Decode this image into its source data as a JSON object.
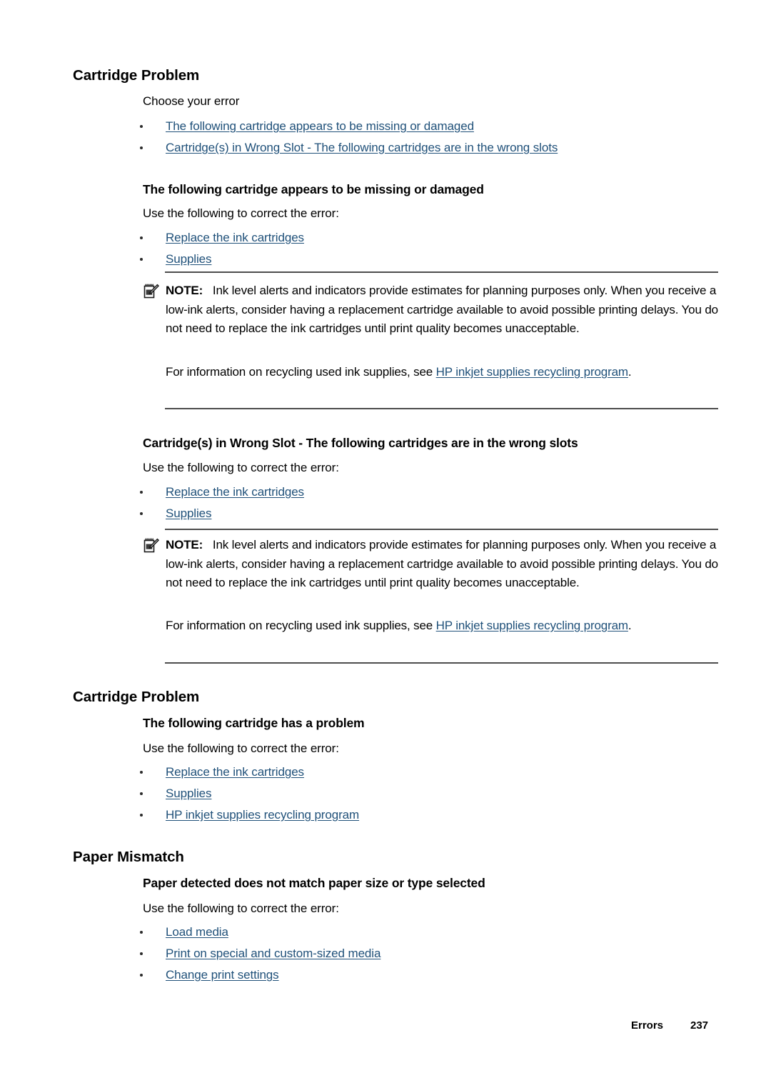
{
  "document": {
    "page_number": "237",
    "footer_section": "Errors",
    "link_color": "#1f5079",
    "rule_color": "#4d4d4d",
    "text_color": "#000000"
  },
  "sections": [
    {
      "id": "cartridge-problem-1",
      "heading": "Cartridge Problem",
      "intro": "Choose your error",
      "toc_links": [
        "The following cartridge appears to be missing or damaged",
        "Cartridge(s) in Wrong Slot - The following cartridges are in the wrong slots"
      ]
    },
    {
      "id": "missing-or-damaged",
      "heading": "The following cartridge appears to be missing or damaged",
      "intro": "Use the following to correct the error:",
      "links": [
        "Replace the ink cartridges",
        "Supplies"
      ]
    },
    {
      "id": "wrong-slot",
      "heading": "Cartridge(s) in Wrong Slot - The following cartridges are in the wrong slots",
      "intro": "Use the following to correct the error:",
      "links": [
        "Replace the ink cartridges",
        "Supplies"
      ]
    },
    {
      "id": "cartridge-problem-2",
      "heading": "Cartridge Problem",
      "subheading": "The following cartridge has a problem",
      "intro": "Use the following to correct the error:",
      "links": [
        "Replace the ink cartridges",
        "Supplies",
        "HP inkjet supplies recycling program"
      ]
    },
    {
      "id": "paper-mismatch",
      "heading": "Paper Mismatch",
      "subheading": "Paper detected does not match paper size or type selected",
      "intro": "Use the following to correct the error:",
      "links": [
        "Load media",
        "Print on special and custom-sized media",
        "Change print settings"
      ]
    }
  ],
  "notes": [
    {
      "id": "note-1",
      "label": "NOTE:",
      "paragraph1": "Ink level alerts and indicators provide estimates for planning purposes only. When you receive a low-ink alerts, consider having a replacement cartridge available to avoid possible printing delays. You do not need to replace the ink cartridges until print quality becomes unacceptable.",
      "paragraph2_before": "For information on recycling used ink supplies, see ",
      "paragraph2_link": "HP inkjet supplies recycling program",
      "paragraph2_after": "."
    },
    {
      "id": "note-2",
      "label": "NOTE:",
      "paragraph1": "Ink level alerts and indicators provide estimates for planning purposes only. When you receive a low-ink alerts, consider having a replacement cartridge available to avoid possible printing delays. You do not need to replace the ink cartridges until print quality becomes unacceptable.",
      "paragraph2_before": "For information on recycling used ink supplies, see ",
      "paragraph2_link": "HP inkjet supplies recycling program",
      "paragraph2_after": "."
    }
  ]
}
